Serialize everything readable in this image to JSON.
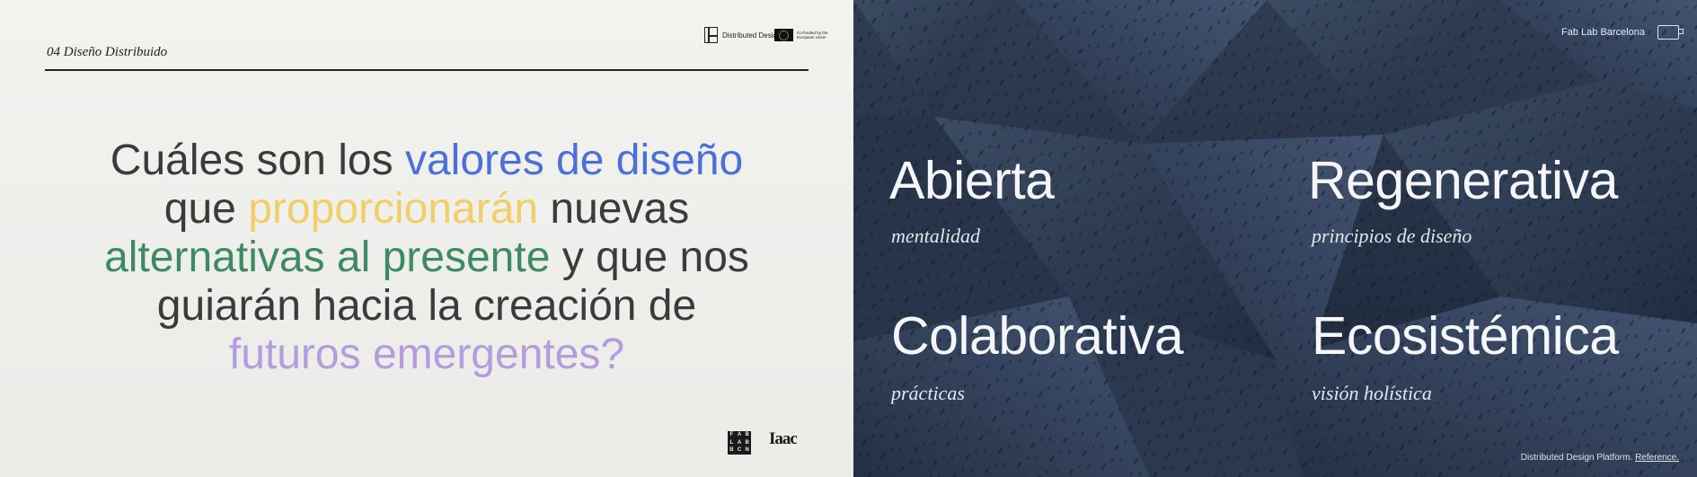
{
  "left_slide": {
    "section_label": "04 Diseño Distribuido",
    "logos": {
      "distributed_design": "Distributed Design",
      "eu_cofunded": "Co-funded by the European Union",
      "fablab_letters": [
        "F",
        "A",
        "B",
        "L",
        "A",
        "B",
        "B",
        "C",
        "N"
      ],
      "iaac": "Iaac"
    },
    "question": {
      "seg1": "Cuáles son los ",
      "seg2": "valores de diseño",
      "seg3": " que ",
      "seg4": "proporcionarán",
      "seg5": " nuevas ",
      "seg6": "alternativas al presente",
      "seg7": " y que nos guiarán hacia la creación de ",
      "seg8": "futuros emergentes",
      "seg9": "?"
    },
    "colors": {
      "blue": "#4c6fd8",
      "yellow": "#f2ce6b",
      "green": "#3e8a63",
      "purple": "#b49ddf"
    }
  },
  "right_slide": {
    "brand": "Fab Lab Barcelona",
    "brand_icon": "fablab-bracket-icon",
    "values": [
      {
        "title": "Abierta",
        "subtitle": "mentalidad"
      },
      {
        "title": "Regenerativa",
        "subtitle": "principios de diseño"
      },
      {
        "title": "Colaborativa",
        "subtitle": "prácticas"
      },
      {
        "title": "Ecosistémica",
        "subtitle": "visión holística"
      }
    ],
    "footer": {
      "text": "Distributed Design Platform. ",
      "link": "Reference."
    }
  }
}
